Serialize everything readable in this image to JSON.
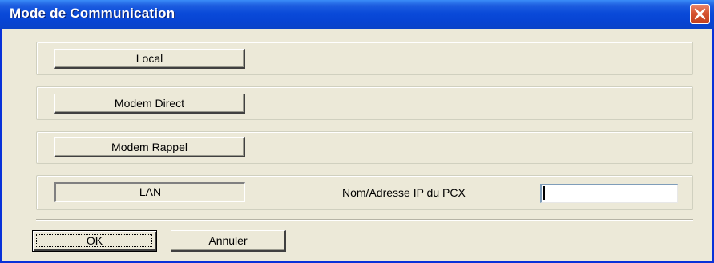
{
  "window": {
    "title": "Mode de Communication"
  },
  "modes": {
    "local_label": "Local",
    "modem_direct_label": "Modem Direct",
    "modem_rappel_label": "Modem Rappel",
    "lan_label": "LAN"
  },
  "lan": {
    "ip_label": "Nom/Adresse IP du PCX",
    "ip_value": ""
  },
  "actions": {
    "ok_label": "OK",
    "cancel_label": "Annuler"
  },
  "icons": {
    "close": "close-icon"
  },
  "colors": {
    "titlebar": "#0a4ad9",
    "close_button": "#d65432",
    "dialog_background": "#ece9d8"
  }
}
